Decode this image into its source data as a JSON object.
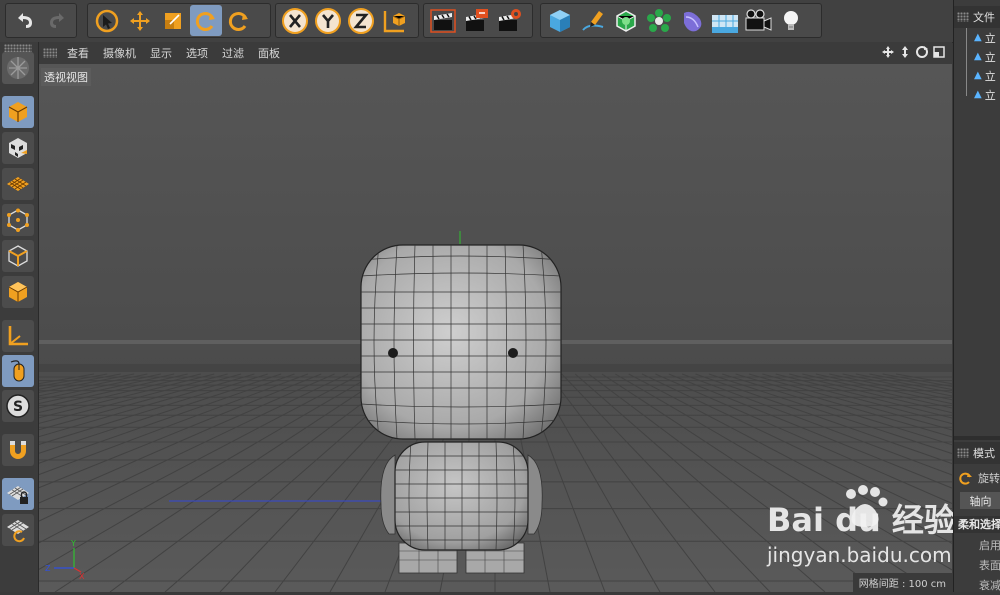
{
  "viewport": {
    "menu": [
      "查看",
      "摄像机",
      "显示",
      "选项",
      "过滤",
      "面板"
    ],
    "view_name": "透视视图",
    "grid_info": "网格间距 : 100 cm"
  },
  "axis_gizmo": {
    "y": "Y",
    "z": "Z",
    "x": "X"
  },
  "right_panel": {
    "objects_header": "文件",
    "objects": [
      "立",
      "立",
      "立",
      "立"
    ],
    "attributes_header": "模式",
    "attr_rotate": "旋转",
    "attr_tab": "轴向",
    "attr_section": "柔和选择",
    "attr_rows": [
      "启用",
      "表面",
      "衰减"
    ]
  },
  "watermark": {
    "logo": "Bai du 经验",
    "url": "jingyan.baidu.com"
  },
  "colors": {
    "active_button": "#7f9bc0",
    "accent_orange": "#f0a020",
    "viewport_bg": "#4d4d4d",
    "axis_x": "#e03030",
    "axis_y": "#30c030",
    "axis_z": "#3050e0"
  },
  "icons": {
    "top_toolbar": [
      "undo-icon",
      "redo-icon",
      "live-selection-icon",
      "move-icon",
      "scale-icon",
      "rotate-icon",
      "recent-tool-icon",
      "x-axis-lock-icon",
      "y-axis-lock-icon",
      "z-axis-lock-icon",
      "coordinate-system-icon",
      "render-view-icon",
      "render-to-picture-viewer-icon",
      "render-settings-icon",
      "cube-icon",
      "pen-spline-icon",
      "subdivision-surface-icon",
      "cloner-icon",
      "deformer-icon",
      "floor-icon",
      "camera-icon",
      "light-icon"
    ],
    "left_toolbar": [
      "make-editable-icon",
      "model-mode-icon",
      "texture-mode-icon",
      "workplane-mode-icon",
      "points-mode-icon",
      "edges-mode-icon",
      "polygons-mode-icon",
      "axis-mode-icon",
      "tweak-mode-icon",
      "solo-icon",
      "snap-icon",
      "workplane-lock-icon",
      "workplane-align-icon"
    ]
  }
}
